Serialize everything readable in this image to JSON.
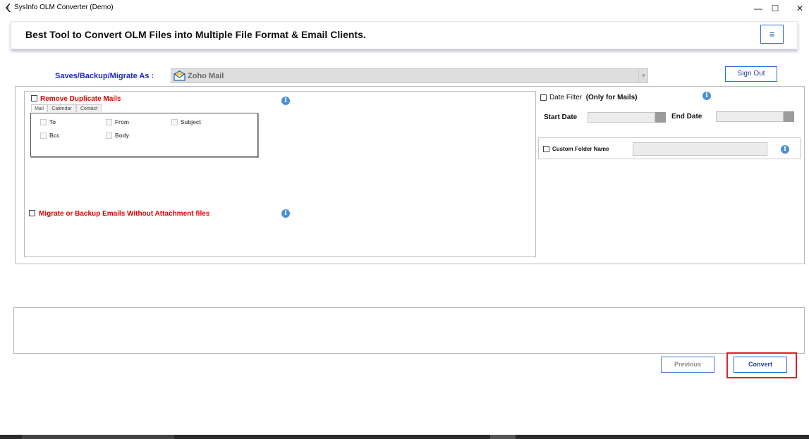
{
  "window": {
    "title": "SysInfo OLM Converter (Demo)",
    "controls": {
      "minimize": "—",
      "maximize": "☐",
      "close": "✕"
    }
  },
  "header": {
    "title": "Best Tool to Convert OLM Files into Multiple File Format & Email Clients.",
    "menu_icon": "≡"
  },
  "saves": {
    "label": "Saves/Backup/Migrate As :",
    "selected": "Zoho Mail",
    "icon": "envelope-icon"
  },
  "account": {
    "sign_out": "Sign Out"
  },
  "filters": {
    "remove_duplicates": {
      "label": "Remove Duplicate Mails",
      "checked": false,
      "tabs": [
        "Mail",
        "Calendar",
        "Contact"
      ],
      "active_tab": "Mail",
      "fields": [
        "To",
        "From",
        "Subject",
        "Bcc",
        "Body"
      ]
    },
    "no_attachments": {
      "label": "Migrate or Backup Emails Without Attachment files",
      "checked": false
    },
    "date_filter": {
      "label": "Date Filter",
      "note": "(Only for Mails)",
      "checked": false,
      "start_label": "Start Date",
      "end_label": "End Date"
    },
    "custom_folder": {
      "label": "Custom Folder Name",
      "checked": false,
      "value": ""
    },
    "info_icon": "i"
  },
  "log": {
    "text": ""
  },
  "footer": {
    "previous": "Previous",
    "convert": "Convert"
  },
  "colors": {
    "accent_blue": "#2a6fd6",
    "label_blue": "#1c27c3",
    "warning_red": "#e00000",
    "highlight_red": "#d9242a"
  }
}
